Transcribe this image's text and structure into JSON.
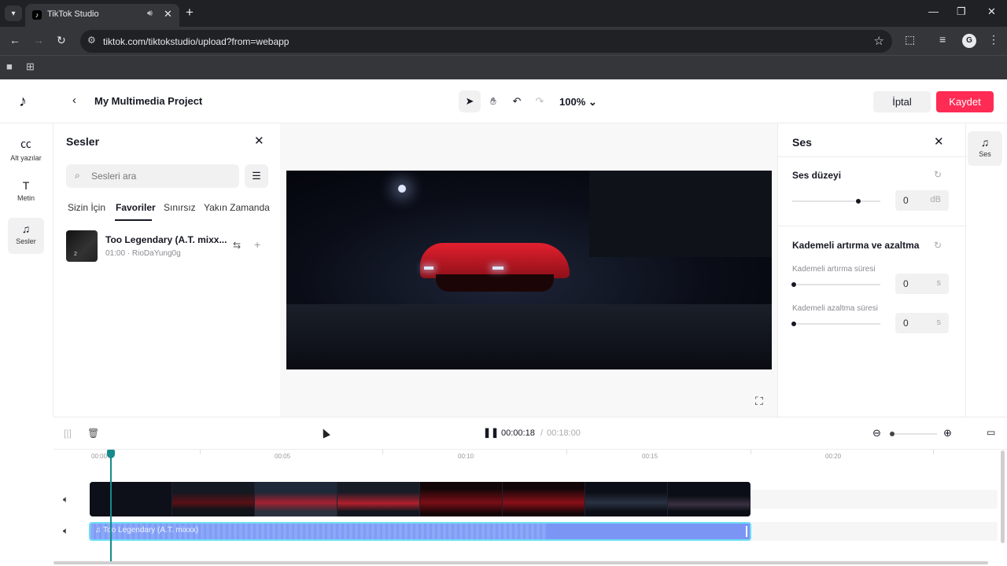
{
  "browser": {
    "tab_title": "TikTok Studio",
    "url": "tiktok.com/tiktokstudio/upload?from=webapp"
  },
  "header": {
    "back_icon": "chevron-left-icon",
    "project_title": "My Multimedia Project",
    "zoom": "100%",
    "cancel_label": "İptal",
    "save_label": "Kaydet",
    "accent_color": "#fe2c55"
  },
  "left_nav": {
    "items": [
      {
        "label": "Alt yazılar",
        "icon": "captions-icon"
      },
      {
        "label": "Metin",
        "icon": "text-icon"
      },
      {
        "label": "Sesler",
        "icon": "music-icon"
      }
    ]
  },
  "sounds_panel": {
    "title": "Sesler",
    "search_placeholder": "Sesleri ara",
    "tabs": [
      "Sizin İçin",
      "Favoriler",
      "Sınırsız",
      "Yakın Zamanda"
    ],
    "active_tab": "Favoriler",
    "tracks": [
      {
        "name": "Too Legendary (A.T. mixx...",
        "duration": "01:00",
        "artist": "RioDaYung0g",
        "meta": "01:00 · RioDaYung0g"
      }
    ]
  },
  "props_panel": {
    "title": "Ses",
    "volume_title": "Ses düzeyi",
    "volume_value": "0",
    "volume_unit": "dB",
    "volume_level": 0.75,
    "fade_title": "Kademeli artırma ve azaltma",
    "fade_in_label": "Kademeli artırma süresi",
    "fade_in_value": "0",
    "fade_out_label": "Kademeli azaltma süresi",
    "fade_out_value": "0",
    "seconds_unit": "s"
  },
  "right_rail": {
    "label": "Ses"
  },
  "timeline": {
    "current_time": "00:00:18",
    "separator": "/",
    "total_time": "00:18:00",
    "ruler_ticks": [
      "00:00",
      "00:05",
      "00:10",
      "00:15",
      "00:20"
    ],
    "audio_clip_label": "Too Legendary (A.T. mixxx)"
  }
}
